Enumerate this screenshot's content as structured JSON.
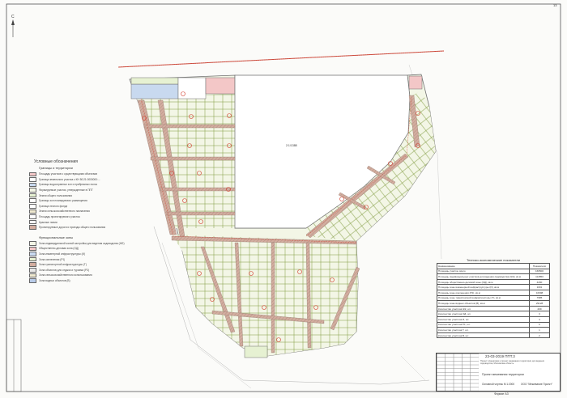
{
  "sheet": {
    "number": "13",
    "format": "Формат А3",
    "north_label": "С"
  },
  "map": {
    "central_parcel_label": "2:1/1388",
    "colors": {
      "road": "#d3ad9f",
      "road_hatch": "#9a7e73",
      "lot_fill": "#f3f6e6",
      "lot_border": "#7f9a3e",
      "red_line": "#d23c2c",
      "water_fill": "#c8d9ef",
      "pink_fill": "#f3c7c7",
      "green_fill": "#e6f1d2",
      "border_line": "#6f6f6f"
    }
  },
  "legend": {
    "title": "Условные обозначения",
    "section1": "Границы и территории",
    "items1": [
      {
        "label": "Площадь участков с существующими объектами",
        "color": "#f3c7c7"
      },
      {
        "label": "Граница земельного участка с КН 50:21:0000000:...",
        "color": "#ffffff"
      },
      {
        "label": "Границы водоохранных зон и прибрежных полос",
        "color": "#c8d9ef"
      },
      {
        "label": "Формируемые участки, утвержденные в ППТ",
        "color": "#f3f6e6"
      },
      {
        "label": "Земли общего пользования",
        "color": "#e6f1d2"
      },
      {
        "label": "Границы зон планируемого размещения",
        "color": "#ffffff"
      },
      {
        "label": "Граница лесного фонда",
        "color": "#ffffff"
      },
      {
        "label": "Земли сельскохозяйственного назначения",
        "color": "#f0ead0"
      },
      {
        "label": "Площадь проектируемого участка",
        "color": "#ffffff"
      },
      {
        "label": "Красные линии",
        "color": "#ffffff"
      },
      {
        "label": "Проектируемые дороги и проезды общего пользования",
        "color": "#d3ad9f"
      }
    ],
    "section2": "Функциональные зоны",
    "items2": [
      {
        "label": "Зона индивидуальной жилой застройки для ведения садоводства (Ж2)",
        "color": "#f3f6e6"
      },
      {
        "label": "Общественно-деловая зона (ОД)",
        "color": "#f3c7c7"
      },
      {
        "label": "Зона инженерной инфраструктуры (И)",
        "color": "#c8d9ef"
      },
      {
        "label": "Зона озеленения (Р1)",
        "color": "#e6f1d2"
      },
      {
        "label": "Зона транспортной инфраструктуры (Т)",
        "color": "#d3ad9f"
      },
      {
        "label": "Зона объектов для отдыха и туризма (Р3)",
        "color": "#e8e8e8"
      },
      {
        "label": "Зона сельскохозяйственного использования",
        "color": "#f0ead0"
      },
      {
        "label": "Зона водных объектов (В)",
        "color": "#b8cbe8"
      }
    ]
  },
  "tep": {
    "title": "Технико-экономические показатели",
    "headers": [
      "Наименование",
      "Показатели"
    ],
    "rows": [
      [
        "Площадь участка, всего",
        "166500"
      ],
      [
        "Площадь индивидуальных участков для ведения садоводства (Ж2), кв.м",
        "112850"
      ],
      [
        "Площадь общественно-деловой зоны (ОД), кв.м",
        "4290"
      ],
      [
        "Площадь зоны инженерной инфраструктуры (И), кв.м",
        "1001"
      ],
      [
        "Площадь зоны озеленения (Р1), кв.м",
        "10998"
      ],
      [
        "Площадь зоны транспортной инфраструктуры (Т), кв.м",
        "7985"
      ],
      [
        "Площадь зоны водных объектов (В), кв.м",
        "29128"
      ],
      [
        "Количество участков Ж2, шт.",
        "209"
      ],
      [
        "Количество участков ОД, шт.",
        "3"
      ],
      [
        "Количество участков И, шт.",
        "4"
      ],
      [
        "Количество участков Р1, шт.",
        "6"
      ],
      [
        "Количество участков Т, шт.",
        "1"
      ],
      [
        "Количество участков В, шт.",
        "2"
      ]
    ]
  },
  "stamp": {
    "code": "23-03-2019 ППТ.3",
    "description": "Проект планировки и проект межевания территории для ведения садоводства, Московская область",
    "project": "Проект межевания территории",
    "scheme": "Основной чертеж М 1:2000",
    "org": "ООО \"Межевание Проект\""
  }
}
